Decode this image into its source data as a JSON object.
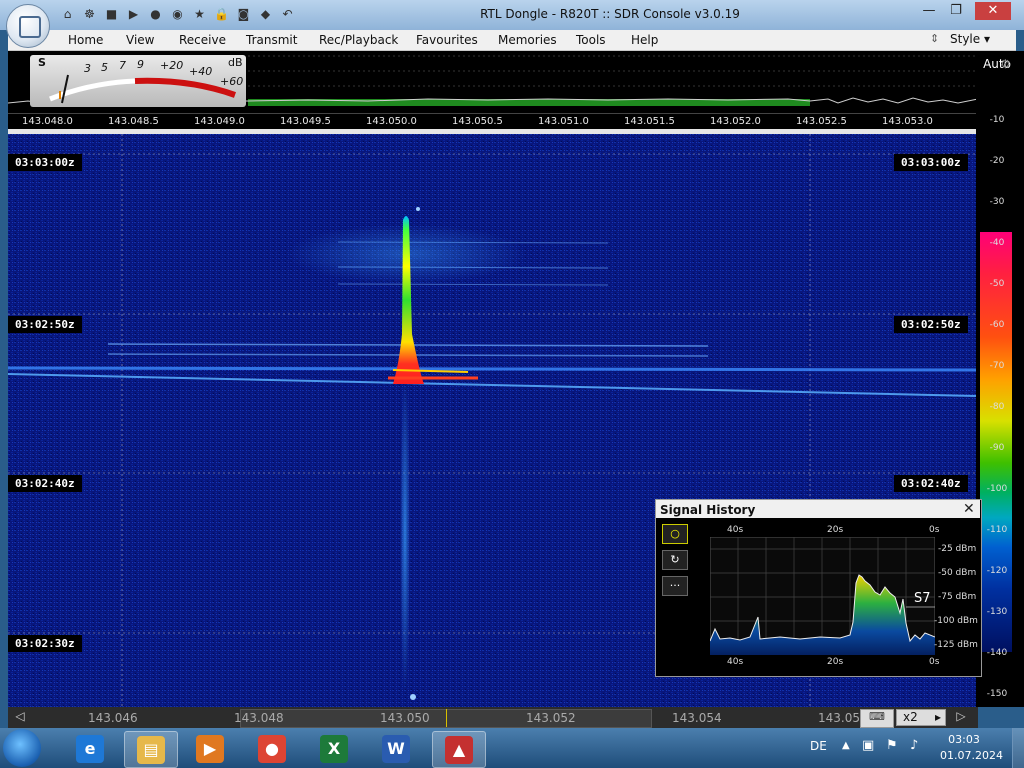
{
  "window": {
    "title": "RTL Dongle - R820T :: SDR Console v3.0.19",
    "controls": [
      "—",
      "❐",
      "✕"
    ]
  },
  "quick_access": [
    "⌂",
    "☸",
    "■",
    "▶",
    "●",
    "◉",
    "★",
    "🔒",
    "◙",
    "◆",
    "↶"
  ],
  "menu": {
    "items": [
      "Home",
      "View",
      "Receive",
      "Transmit",
      "Rec/Playback",
      "Favourites",
      "Memories",
      "Tools",
      "Help"
    ],
    "style_label": "Style"
  },
  "smeter": {
    "s_label": "S",
    "s_ticks": [
      "3",
      "5",
      "7",
      "9"
    ],
    "plus_ticks": [
      "+20",
      "+40",
      "+60"
    ],
    "db_label": "dB"
  },
  "frequency_axis": [
    "143.048.0",
    "143.048.5",
    "143.049.0",
    "143.049.5",
    "143.050.0",
    "143.050.5",
    "143.051.0",
    "143.051.5",
    "143.052.0",
    "143.052.5",
    "143.053.0"
  ],
  "waterfall": {
    "time_labels": [
      "03:03:00z",
      "03:02:50z",
      "03:02:40z",
      "03:02:30z"
    ],
    "right_time_labels": [
      "03:03:00z",
      "03:02:50z",
      "03:02:40z"
    ]
  },
  "db_scale": {
    "auto_label": "Auto",
    "labels": [
      "-10",
      "-20",
      "-30",
      "-40",
      "-50",
      "-60",
      "-70",
      "-80",
      "-90",
      "-100",
      "-110",
      "-120",
      "-130",
      "-140",
      "-150"
    ]
  },
  "bottom_bar": {
    "labels": [
      "143.046",
      "143.048",
      "143.050",
      "143.052",
      "143.054",
      "143.05"
    ],
    "zoom": "x2"
  },
  "signal_history": {
    "title": "Signal History",
    "top_time_labels": [
      "40s",
      "20s",
      "0s"
    ],
    "bottom_time_labels": [
      "40s",
      "20s",
      "0s"
    ],
    "dbm_labels": [
      "-25 dBm",
      "-50 dBm",
      "-75 dBm",
      "-100 dBm",
      "-125 dBm"
    ],
    "s_reading": "S7",
    "buttons": [
      "○",
      "↻",
      "···"
    ],
    "close": "✕"
  },
  "taskbar": {
    "apps": [
      {
        "name": "Internet Explorer",
        "glyph": "e",
        "color": "#1e78d6"
      },
      {
        "name": "File Explorer",
        "glyph": "▤",
        "color": "#e6b84a"
      },
      {
        "name": "Media Player",
        "glyph": "▶",
        "color": "#e07820"
      },
      {
        "name": "Chrome",
        "glyph": "●",
        "color": "#dd4433"
      },
      {
        "name": "Excel",
        "glyph": "X",
        "color": "#1d7a3a"
      },
      {
        "name": "Word",
        "glyph": "W",
        "color": "#2a5cb0"
      },
      {
        "name": "SDR Console",
        "glyph": "▲",
        "color": "#c43030"
      }
    ],
    "language": "DE",
    "time": "03:03",
    "date": "01.07.2024"
  },
  "colors": {
    "waterfall_bg": "#06157a",
    "signal_hot": "#ff2020",
    "meter_red": "#cc1010"
  }
}
